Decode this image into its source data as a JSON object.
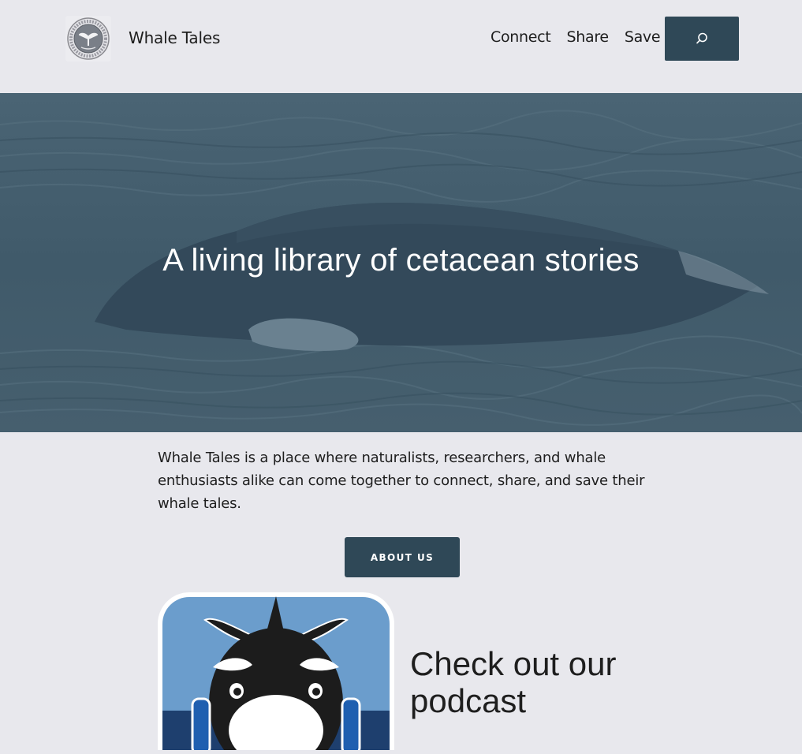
{
  "header": {
    "site_title": "Whale Tales",
    "logo_ring_text": "WHALE-TALES.ORG · CONNECT SHARE SAVE",
    "nav": [
      {
        "label": "Connect"
      },
      {
        "label": "Share"
      },
      {
        "label": "Save"
      }
    ],
    "search_icon": "search-icon"
  },
  "hero": {
    "title": "A living library of cetacean stories"
  },
  "intro": {
    "text": "Whale Tales is a place where naturalists, researchers, and whale enthusiasts alike can come together to connect, share, and save their whale tales."
  },
  "about_button": {
    "label": "ABOUT US"
  },
  "podcast": {
    "heading": "Check out our podcast"
  },
  "colors": {
    "page_bg": "#e8e8ed",
    "accent": "#2f4857",
    "text": "#1e1e1e"
  }
}
